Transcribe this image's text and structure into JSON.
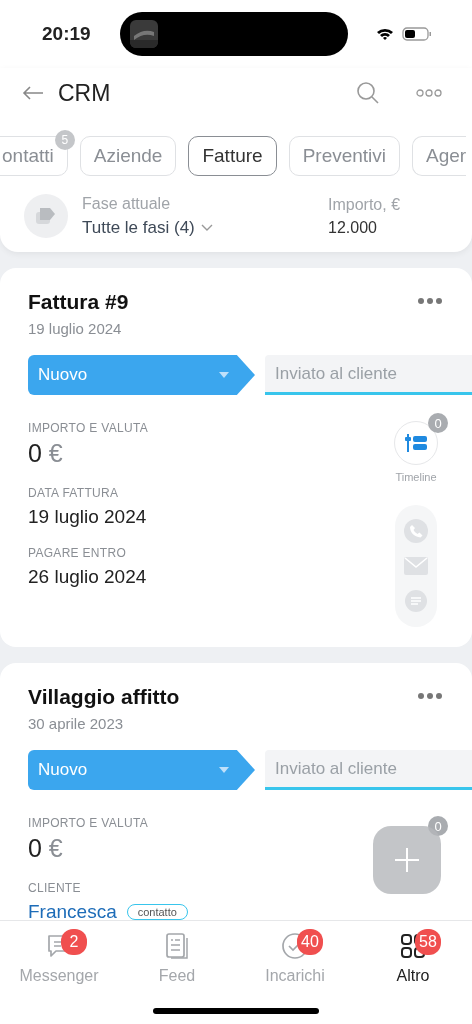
{
  "status_bar": {
    "time": "20:19"
  },
  "header": {
    "title": "CRM"
  },
  "tabs": [
    {
      "label": "ontatti",
      "selected": false,
      "badge": "5"
    },
    {
      "label": "Aziende",
      "selected": false
    },
    {
      "label": "Fatture",
      "selected": true
    },
    {
      "label": "Preventivi",
      "selected": false
    },
    {
      "label": "Ager",
      "selected": false
    }
  ],
  "filter": {
    "stage_label": "Fase attuale",
    "stage_value": "Tutte le fasi (4)",
    "amount_label": "Importo, €",
    "amount_value": "12.000"
  },
  "cards": [
    {
      "title": "Fattura #9",
      "date": "19 luglio 2024",
      "stages": [
        {
          "label": "Nuovo",
          "selected": true
        },
        {
          "label": "Inviato al cliente",
          "selected": false
        }
      ],
      "fields": [
        {
          "kind": "amount",
          "label": "IMPORTO E VALUTA",
          "value": "0",
          "currency": "€"
        },
        {
          "kind": "text",
          "label": "DATA FATTURA",
          "value": "19 luglio 2024"
        },
        {
          "kind": "text",
          "label": "PAGARE ENTRO",
          "value": "26 luglio 2024"
        }
      ],
      "timeline": {
        "label": "Timeline",
        "badge": "0"
      },
      "contact_actions": true
    },
    {
      "title": "Villaggio affitto",
      "date": "30 aprile 2023",
      "stages": [
        {
          "label": "Nuovo",
          "selected": true
        },
        {
          "label": "Inviato al cliente",
          "selected": false
        }
      ],
      "fields": [
        {
          "kind": "amount",
          "label": "IMPORTO E VALUTA",
          "value": "0",
          "currency": "€"
        },
        {
          "kind": "client",
          "label": "CLIENTE",
          "value": "Francesca",
          "tag": "contatto"
        }
      ],
      "timeline": {
        "badge": "0"
      },
      "contact_actions": false
    }
  ],
  "nav": [
    {
      "label": "Messenger",
      "badge": "2",
      "selected": false
    },
    {
      "label": "Feed",
      "selected": false
    },
    {
      "label": "Incarichi",
      "badge": "40",
      "selected": false
    },
    {
      "label": "Altro",
      "badge": "58",
      "selected": true
    }
  ]
}
